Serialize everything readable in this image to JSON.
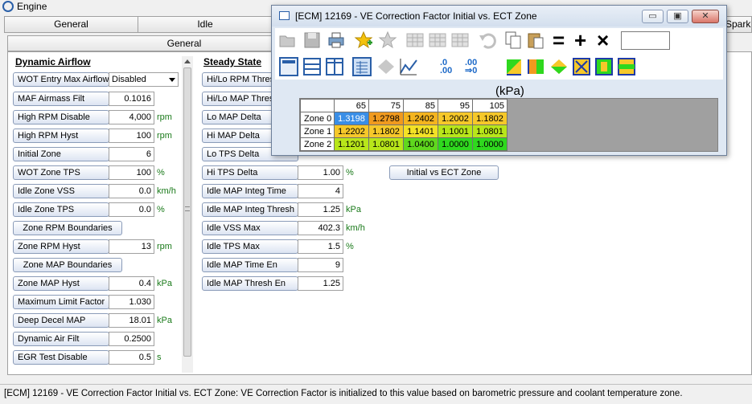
{
  "window": {
    "title": "Engine"
  },
  "tabs": [
    {
      "label": "General"
    },
    {
      "label": "Idle"
    },
    {
      "label": "Spark"
    }
  ],
  "subtab": {
    "label": "General"
  },
  "dynamic_airflow": {
    "heading": "Dynamic Airflow",
    "wot_entry": {
      "label": "WOT Entry Max Airflow",
      "value": "Disabled"
    },
    "rows": [
      {
        "label": "MAF Airmass Filt",
        "value": "0.1016",
        "unit": ""
      },
      {
        "label": "High RPM Disable",
        "value": "4,000",
        "unit": "rpm"
      },
      {
        "label": "High RPM Hyst",
        "value": "100",
        "unit": "rpm"
      },
      {
        "label": "Initial Zone",
        "value": "6",
        "unit": ""
      },
      {
        "label": "WOT Zone TPS",
        "value": "100",
        "unit": "%"
      },
      {
        "label": "Idle Zone VSS",
        "value": "0.0",
        "unit": "km/h"
      },
      {
        "label": "Idle Zone TPS",
        "value": "0.0",
        "unit": "%"
      }
    ],
    "zone_rpm_boundaries": "Zone RPM Boundaries",
    "zone_rpm_hyst": {
      "label": "Zone RPM Hyst",
      "value": "13",
      "unit": "rpm"
    },
    "zone_map_boundaries": "Zone MAP Boundaries",
    "rows2": [
      {
        "label": "Zone MAP Hyst",
        "value": "0.4",
        "unit": "kPa"
      },
      {
        "label": "Maximum Limit Factor",
        "value": "1.030",
        "unit": ""
      },
      {
        "label": "Deep Decel MAP",
        "value": "18.01",
        "unit": "kPa"
      },
      {
        "label": "Dynamic Air Filt",
        "value": "0.2500",
        "unit": ""
      },
      {
        "label": "EGR Test Disable",
        "value": "0.5",
        "unit": "s"
      }
    ]
  },
  "steady_state": {
    "heading": "Steady State",
    "rows_top": [
      {
        "label": "Hi/Lo RPM Thresh"
      },
      {
        "label": "Hi/Lo MAP Thresh"
      },
      {
        "label": "Lo MAP Delta"
      },
      {
        "label": "Hi MAP Delta"
      },
      {
        "label": "Lo TPS Delta"
      }
    ],
    "rows": [
      {
        "label": "Hi TPS Delta",
        "value": "1.00",
        "unit": "%"
      },
      {
        "label": "Idle MAP Integ Time",
        "value": "4",
        "unit": ""
      },
      {
        "label": "Idle MAP Integ Thresh",
        "value": "1.25",
        "unit": "kPa"
      },
      {
        "label": "Idle VSS Max",
        "value": "402.3",
        "unit": "km/h"
      },
      {
        "label": "Idle TPS Max",
        "value": "1.5",
        "unit": "%"
      },
      {
        "label": "Idle MAP Time En",
        "value": "9",
        "unit": ""
      },
      {
        "label": "Idle MAP Thresh En",
        "value": "1.25",
        "unit": ""
      }
    ],
    "initial_vs_ect_button": "Initial vs ECT Zone"
  },
  "ve_window": {
    "title": "[ECM] 12169 - VE Correction Factor Initial vs. ECT Zone",
    "units": "(kPa)",
    "col_headers": [
      "65",
      "75",
      "85",
      "95",
      "105"
    ],
    "rows": [
      {
        "label": "Zone 0",
        "cells": [
          "1.3198",
          "1.2798",
          "1.2402",
          "1.2002",
          "1.1802"
        ]
      },
      {
        "label": "Zone 1",
        "cells": [
          "1.2202",
          "1.1802",
          "1.1401",
          "1.1001",
          "1.0801"
        ]
      },
      {
        "label": "Zone 2",
        "cells": [
          "1.1201",
          "1.0801",
          "1.0400",
          "1.0000",
          "1.0000"
        ]
      }
    ],
    "cell_colors": [
      [
        "#3a8ee6",
        "#f09a1f",
        "#f4b41f",
        "#f6c82a",
        "#f6c82a"
      ],
      [
        "#f6c82a",
        "#f6c82a",
        "#f3e226",
        "#b8e61a",
        "#b8e61a"
      ],
      [
        "#b8e61a",
        "#b8e61a",
        "#5fd81e",
        "#2fd81e",
        "#2fd81e"
      ]
    ],
    "toolbar_icons": [
      "open-icon",
      "save-icon",
      "print-icon",
      "star-add-icon",
      "star-icon",
      "table-icon",
      "table-icon",
      "table-icon",
      "undo-icon",
      "copy-icon",
      "paste-icon"
    ],
    "ops": [
      "=",
      "+",
      "×"
    ],
    "toolbar2_labels": [
      ".0",
      ".00",
      ".00",
      "⇒0"
    ]
  },
  "status": {
    "text": "[ECM] 12169 - VE Correction Factor Initial vs. ECT Zone: VE Correction Factor is initialized to this value based on barometric pressure and coolant temperature zone."
  }
}
